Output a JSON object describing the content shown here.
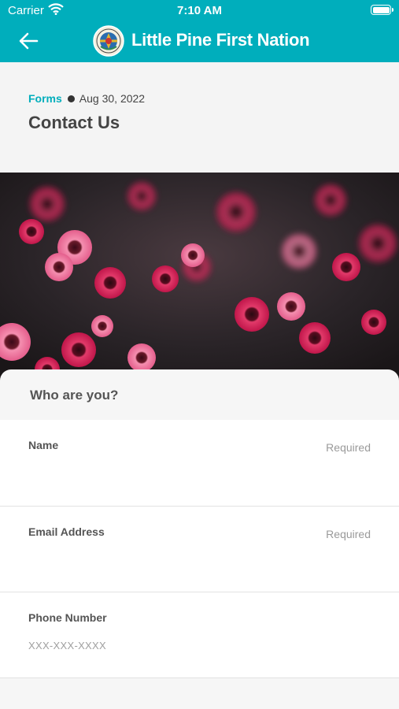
{
  "status_bar": {
    "carrier": "Carrier",
    "time": "7:10 AM"
  },
  "header": {
    "title": "Little Pine  First Nation",
    "back_icon": "arrow-left-icon",
    "logo": "nation-seal-logo"
  },
  "article": {
    "category": "Forms",
    "date": "Aug 30, 2022",
    "title": "Contact Us"
  },
  "hero": {
    "image": "pink-flowers-photo"
  },
  "form": {
    "section_title": "Who are you?",
    "fields": [
      {
        "label": "Name",
        "hint": "Required",
        "value": ""
      },
      {
        "label": "Email Address",
        "hint": "Required",
        "value": ""
      },
      {
        "label": "Phone Number",
        "placeholder": "XXX-XXX-XXXX",
        "value": ""
      }
    ]
  },
  "colors": {
    "brand": "#00aebc",
    "background": "#f4f4f4",
    "text": "#444444"
  }
}
